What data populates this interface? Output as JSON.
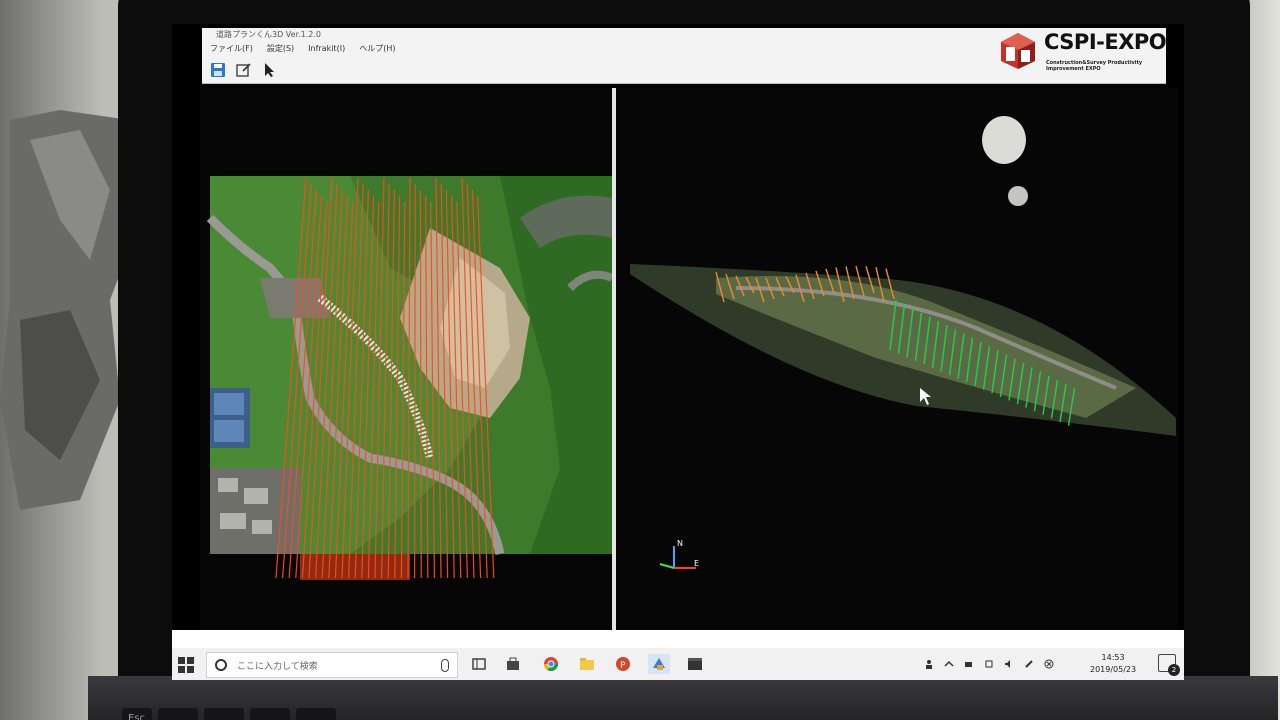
{
  "app": {
    "title": "道路プランくん3D Ver.1.2.0",
    "menu": [
      "ファイル(F)",
      "設定(S)",
      "Infrakit(I)",
      "ヘルプ(H)"
    ],
    "toolbar": [
      "save-icon",
      "edit-icon",
      "pointer-icon"
    ]
  },
  "watermark": {
    "main": "CSPI-EXPO",
    "sub": "Construction&Survey Productivity Improvement EXPO",
    "colors": {
      "accent": "#c2332b",
      "text": "#111111"
    }
  },
  "viewports": {
    "left": {
      "view": "top-down aerial map",
      "route_color": "#ff4a1a"
    },
    "right": {
      "view": "3D perspective",
      "route_colors": [
        "#f08a2a",
        "#22d14a"
      ],
      "axis_labels": [
        "N",
        "E"
      ]
    }
  },
  "taskbar": {
    "search_placeholder": "ここに入力して検索",
    "apps": [
      "task-view-icon",
      "store-icon",
      "chrome-icon",
      "file-explorer-icon",
      "powerpoint-icon",
      "app-icon",
      "video-editor-icon"
    ],
    "time": "14:53",
    "date": "2019/05/23",
    "notification_count": "2"
  },
  "keyboard": {
    "esc_label": "Esc"
  }
}
